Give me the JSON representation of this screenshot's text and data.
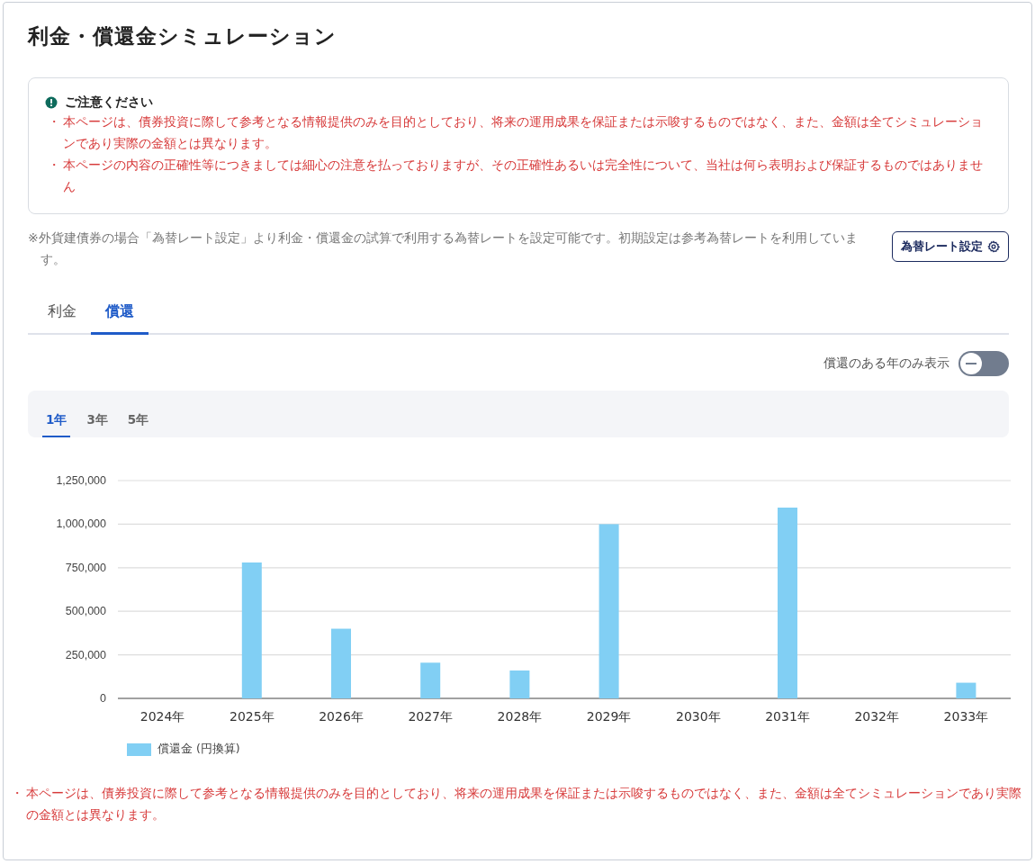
{
  "title": "利金・償還金シミュレーション",
  "notice": {
    "heading": "ご注意ください",
    "items": [
      {
        "bullet": "・",
        "text": "本ページは、債券投資に際して参考となる情報提供のみを目的としており、将来の運用成果を保証または示唆するものではなく、また、金額は全てシミュレーションであり実際の金額とは異なります。"
      },
      {
        "bullet": "・",
        "text": "本ページの内容の正確性等につきましては細心の注意を払っておりますが、その正確性あるいは完全性について、当社は何ら表明および保証するものではありません"
      }
    ]
  },
  "fx_note": "※外貨建債券の場合「為替レート設定」より利金・償還金の試算で利用する為替レートを設定可能です。初期設定は参考為替レートを利用しています。",
  "fx_button": "為替レート設定",
  "tabs": [
    {
      "label": "利金",
      "selected": false
    },
    {
      "label": "償還",
      "selected": true
    }
  ],
  "toggle": {
    "label": "償還のある年のみ表示",
    "on": false
  },
  "periods": [
    {
      "label": "1年",
      "selected": true
    },
    {
      "label": "3年",
      "selected": false
    },
    {
      "label": "5年",
      "selected": false
    }
  ],
  "chart_data": {
    "type": "bar",
    "categories": [
      "2024年",
      "2025年",
      "2026年",
      "2027年",
      "2028年",
      "2029年",
      "2030年",
      "2031年",
      "2032年",
      "2033年"
    ],
    "series": [
      {
        "name": "償還金 (円換算)",
        "color": "#81cff4",
        "values": [
          0,
          780000,
          400000,
          205000,
          160000,
          1000000,
          0,
          1095000,
          0,
          90000
        ]
      }
    ],
    "ylim": [
      0,
      1250000
    ],
    "grid": true,
    "yticks": [
      {
        "value": 0,
        "label": "0"
      },
      {
        "value": 250000,
        "label": "250,000"
      },
      {
        "value": 500000,
        "label": "500,000"
      },
      {
        "value": 750000,
        "label": "750,000"
      },
      {
        "value": 1000000,
        "label": "1,000,000"
      },
      {
        "value": 1250000,
        "label": "1,250,000"
      }
    ]
  },
  "footer_note": {
    "bullet": "・",
    "text": "本ページは、債券投資に際して参考となる情報提供のみを目的としており、将来の運用成果を保証または示唆するものではなく、また、金額は全てシミュレーションであり実際の金額とは異なります。"
  }
}
